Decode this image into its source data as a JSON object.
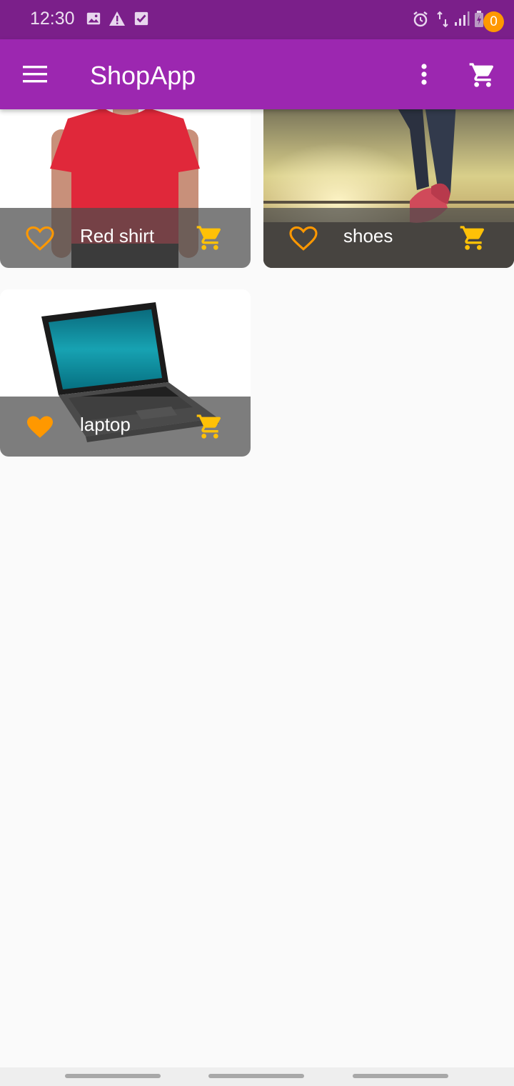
{
  "status_bar": {
    "time": "12:30",
    "left_icons": [
      "image-icon",
      "warning-icon",
      "check-box-icon"
    ],
    "right_icons": [
      "alarm-icon",
      "data-arrows-icon",
      "signal-icon",
      "battery-charging-icon"
    ]
  },
  "app_bar": {
    "title": "ShopApp",
    "cart_count": "0",
    "icons": [
      "menu-icon",
      "more-vert-icon",
      "shopping-cart-icon"
    ]
  },
  "products": [
    {
      "title": "Red shirt",
      "favorite": false
    },
    {
      "title": "shoes",
      "favorite": false
    },
    {
      "title": "laptop",
      "favorite": true
    }
  ],
  "colors": {
    "status_bar": "#7b1f8a",
    "app_bar": "#9c27b0",
    "accent_orange": "#ff9800",
    "cart_yellow": "#ffc107",
    "background": "#fafafa"
  }
}
